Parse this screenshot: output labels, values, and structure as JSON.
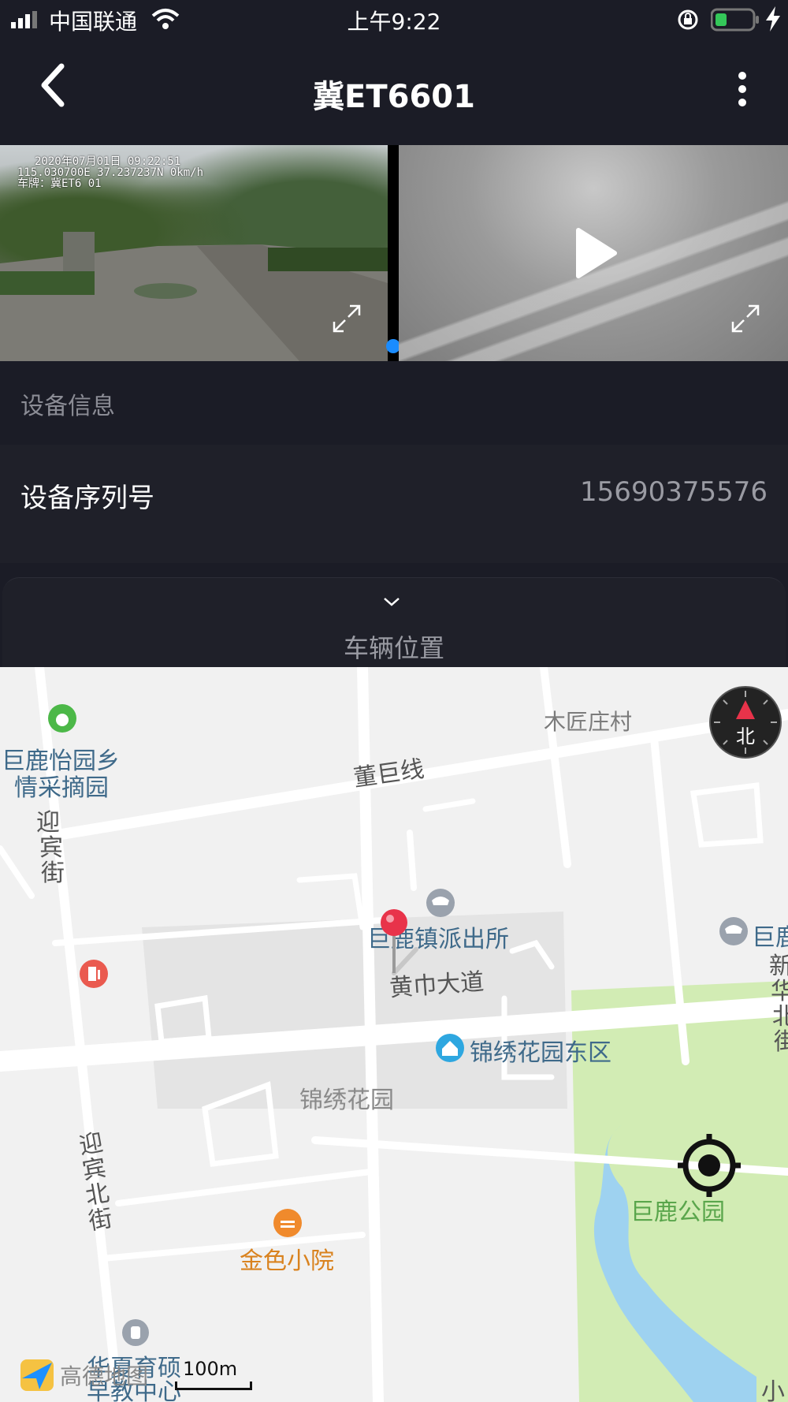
{
  "status_bar": {
    "carrier": "中国联通",
    "time": "上午9:22"
  },
  "header": {
    "title": "冀ET6601"
  },
  "video": {
    "osd_line1": "2020年07月01日 09:22:51",
    "osd_line2": "115.030700E 37.237237N 0km/h",
    "osd_line3": "车牌：冀ET6 01"
  },
  "device_info": {
    "section_label": "设备信息",
    "serial_label": "设备序列号",
    "serial_value": "15690375576"
  },
  "location_sheet": {
    "title": "车辆位置"
  },
  "map": {
    "compass_label": "北",
    "scale_label": "100m",
    "logo_text": "高德地图",
    "labels": {
      "orchard": "巨鹿怡园乡",
      "orchard2": "情采摘园",
      "village": "木匠庄村",
      "road_dongju": "董巨线",
      "road_yingbin_1": "迎",
      "road_yingbin_2": "宾",
      "road_yingbin_3": "街",
      "police": "巨鹿镇派出所",
      "police_right": "巨鹿",
      "road_huangjin": "黄巾大道",
      "jinxiu_east": "锦绣花园东区",
      "jinxiu": "锦绣花园",
      "road_yingbin_north_1": "迎",
      "road_yingbin_north_2": "宾",
      "road_yingbin_north_3": "北",
      "road_yingbin_north_4": "街",
      "xinhua_1": "新",
      "xinhua_2": "华",
      "xinhua_3": "北",
      "xinhua_4": "街",
      "restaurant": "金色小院",
      "school1": "华夏育硕",
      "school2": "早教中心",
      "park": "巨鹿公园",
      "xiao": "小"
    },
    "colors": {
      "park": "#d2ecb4",
      "water": "#9ed2f0",
      "road": "#ffffff",
      "pin": "#e8334a"
    }
  }
}
